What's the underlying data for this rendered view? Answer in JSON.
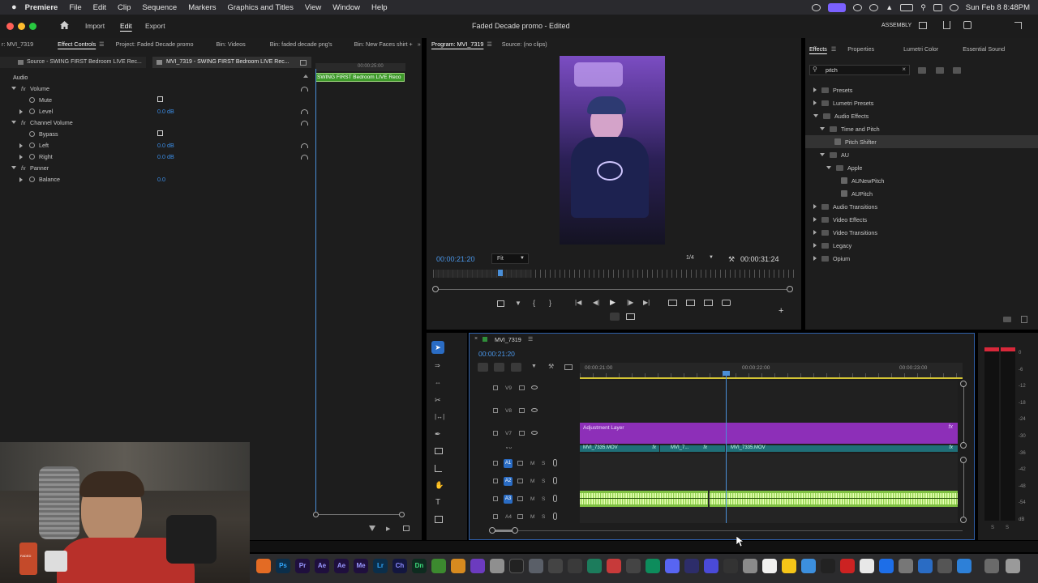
{
  "menubar": {
    "app_name": "Premiere",
    "items": [
      "File",
      "Edit",
      "Clip",
      "Sequence",
      "Markers",
      "Graphics and Titles",
      "View",
      "Window",
      "Help"
    ],
    "datetime": "Sun Feb 8  8:48PM"
  },
  "header": {
    "nav": [
      "Import",
      "Edit",
      "Export"
    ],
    "active_nav": "Edit",
    "project_title": "Faded Decade promo - Edited",
    "workspace": "ASSEMBLY"
  },
  "left_tabs": [
    "r: MVI_7319",
    "Effect Controls",
    "Project: Faded Decade promo",
    "Bin: Videos",
    "Bin: faded decade png's",
    "Bin: New Faces shirt +"
  ],
  "effect_controls": {
    "source_label": "Source - SWING FIRST Bedroom LIVE Rec...",
    "clip_label": "MVI_7319 - SWING FIRST Bedroom LIVE Rec...",
    "ruler_time": "00:00:25:00",
    "clip_bar": "SWING FIRST Bedroom LIVE Reco",
    "section": "Audio",
    "rows": [
      {
        "name": "Volume",
        "value": ""
      },
      {
        "name": "Mute",
        "value": ""
      },
      {
        "name": "Level",
        "value": "0.0 dB"
      },
      {
        "name": "Channel Volume",
        "value": ""
      },
      {
        "name": "Bypass",
        "value": ""
      },
      {
        "name": "Left",
        "value": "0.0 dB"
      },
      {
        "name": "Right",
        "value": "0.0 dB"
      },
      {
        "name": "Panner",
        "value": ""
      },
      {
        "name": "Balance",
        "value": "0.0"
      }
    ]
  },
  "program": {
    "tab_program": "Program: MVI_7319",
    "tab_source": "Source: (no clips)",
    "timecode": "00:00:21:20",
    "fit": "Fit",
    "resolution": "1/4",
    "duration": "00:00:31:24"
  },
  "effects_panel": {
    "tabs": [
      "Effects",
      "Properties",
      "Lumetri Color",
      "Essential Sound"
    ],
    "search": "pitch",
    "tree": [
      {
        "label": "Presets",
        "depth": 0,
        "open": false,
        "kind": "folder"
      },
      {
        "label": "Lumetri Presets",
        "depth": 0,
        "open": false,
        "kind": "folder"
      },
      {
        "label": "Audio Effects",
        "depth": 0,
        "open": true,
        "kind": "folder"
      },
      {
        "label": "Time and Pitch",
        "depth": 1,
        "open": true,
        "kind": "folder"
      },
      {
        "label": "Pitch Shifter",
        "depth": 2,
        "open": false,
        "kind": "effect"
      },
      {
        "label": "AU",
        "depth": 1,
        "open": true,
        "kind": "folder"
      },
      {
        "label": "Apple",
        "depth": 2,
        "open": true,
        "kind": "folder"
      },
      {
        "label": "AUNewPitch",
        "depth": 3,
        "open": false,
        "kind": "effect"
      },
      {
        "label": "AUPitch",
        "depth": 3,
        "open": false,
        "kind": "effect"
      },
      {
        "label": "Audio Transitions",
        "depth": 0,
        "open": false,
        "kind": "folder"
      },
      {
        "label": "Video Effects",
        "depth": 0,
        "open": false,
        "kind": "folder"
      },
      {
        "label": "Video Transitions",
        "depth": 0,
        "open": false,
        "kind": "folder"
      },
      {
        "label": "Legacy",
        "depth": 0,
        "open": false,
        "kind": "folder"
      },
      {
        "label": "Opium",
        "depth": 0,
        "open": false,
        "kind": "folder"
      }
    ]
  },
  "timeline": {
    "sequence_tab": "MVI_7319",
    "timecode": "00:00:21:20",
    "ruler": [
      "00:00:21:00",
      "00:00:22:00",
      "00:00:23:00"
    ],
    "video_tracks": [
      "V9",
      "V8",
      "V7",
      "V6"
    ],
    "audio_tracks": [
      "A1",
      "A2",
      "A3",
      "A4"
    ],
    "adjustment_layer": "Adjustment Layer",
    "clips": [
      "MVI_7335.MOV",
      "MVI_7...",
      "MVI_7335.MOV"
    ],
    "track_m": "M",
    "track_s": "S"
  },
  "meter": {
    "labels": [
      "0",
      "-6",
      "-12",
      "-18",
      "-24",
      "-30",
      "-36",
      "-42",
      "-48",
      "-54",
      "dB"
    ],
    "footer": [
      "S",
      "S"
    ]
  },
  "dock": [
    "Ps",
    "Pr",
    "Ae",
    "Ae",
    "Me",
    "Lr",
    "Ch",
    "Dn"
  ],
  "webcam": {
    "mug_text": "FADED"
  }
}
